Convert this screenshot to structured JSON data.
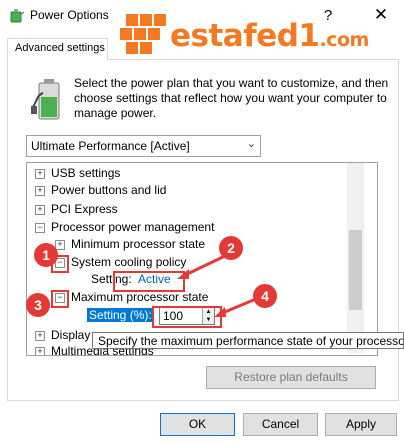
{
  "window": {
    "title": "Power Options",
    "help": "?",
    "close": "✕"
  },
  "tab": {
    "label": "Advanced settings"
  },
  "watermark": {
    "text": "estafed1",
    "tld": ".com"
  },
  "description": "Select the power plan that you want to customize, and then choose settings that reflect how you want your computer to manage power.",
  "plan_select": {
    "value": "Ultimate Performance [Active]",
    "chevron_icon": "chevron-down-icon"
  },
  "tree": {
    "items": [
      {
        "label": "USB settings",
        "toggle": "+"
      },
      {
        "label": "Power buttons and lid",
        "toggle": "+"
      },
      {
        "label": "PCI Express",
        "toggle": "+"
      },
      {
        "label": "Processor power management",
        "toggle": "−"
      },
      {
        "label": "Minimum processor state",
        "toggle": "+"
      },
      {
        "label": "System cooling policy",
        "toggle": "−"
      },
      {
        "label": "Maximum processor state",
        "toggle": "−"
      },
      {
        "label": "Display",
        "toggle": "+"
      },
      {
        "label": "Multimedia settings",
        "toggle": "+"
      }
    ],
    "cooling_setting_label": "Setting:",
    "cooling_setting_value": "Active",
    "max_setting_label": "Setting (%):",
    "max_setting_value": "100"
  },
  "tooltip": "Specify the maximum performance state of your processor",
  "buttons": {
    "restore": "Restore plan defaults",
    "ok": "OK",
    "cancel": "Cancel",
    "apply": "Apply"
  },
  "annotations": [
    "1",
    "2",
    "3",
    "4"
  ],
  "colors": {
    "annotation_red": "#e53935",
    "watermark_orange": "#f47920",
    "link_blue": "#0066cc",
    "selection_blue": "#0078d7"
  }
}
